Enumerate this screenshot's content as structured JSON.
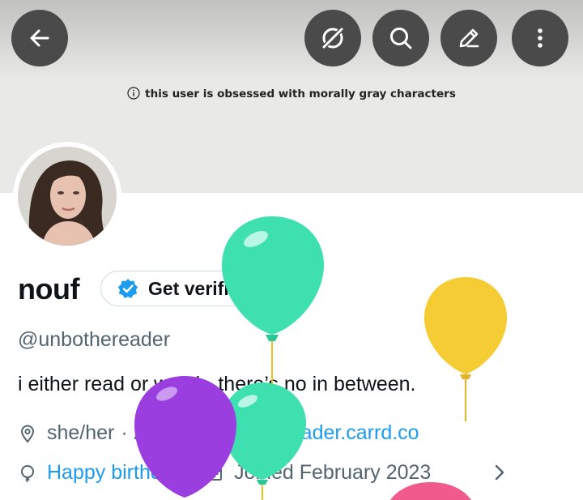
{
  "banner": {
    "notice": "this user is obsessed with morally gray characters"
  },
  "header": {
    "back_icon": "arrow-left-icon",
    "actions": [
      "compass-icon",
      "search-icon",
      "edit-icon",
      "more-vertical-icon"
    ]
  },
  "profile": {
    "name": "nouf",
    "verify_label": "Get verified",
    "handle": "@unbothereader",
    "bio": "i either read or watch, there’s no in between.",
    "pronouns": "she/her",
    "age": "· 20+",
    "link": "unbothereader.carrd.co",
    "birthday": "Happy birthday!",
    "joined": "Joined February 2023"
  },
  "colors": {
    "link": "#1d9bf0",
    "secondary_text": "#536471",
    "balloon_teal": "#3fe0b0",
    "balloon_yellow": "#f5cc33",
    "balloon_purple": "#9a3ee0",
    "balloon_pink": "#f05a8c"
  }
}
